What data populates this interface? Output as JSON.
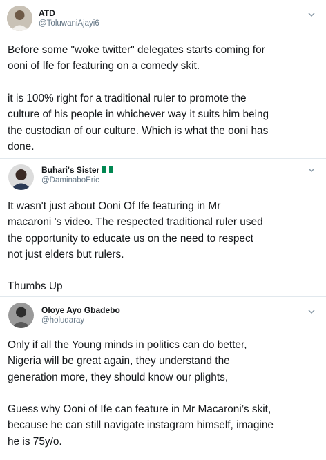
{
  "tweets": [
    {
      "display_name": "ATD",
      "handle": "@ToluwaniAjayi6",
      "paragraphs": [
        "Before some \"woke twitter\" delegates starts coming for\nooni of Ife for featuring on a comedy skit.",
        "it is 100% right for a traditional ruler to promote the\nculture of his people in whichever way it suits him being\nthe custodian of our culture. Which is what the ooni has\ndone."
      ]
    },
    {
      "display_name": "Buhari's Sister",
      "name_emoji": "nigeria-flag",
      "handle": "@DaminaboEric",
      "paragraphs": [
        "It wasn't just about Ooni Of Ife featuring in Mr\nmacaroni 's video. The respected traditional ruler used\nthe opportunity to educate us on the need to respect\nnot just elders but rulers.",
        "Thumbs Up"
      ]
    },
    {
      "display_name": "Oloye Ayo Gbadebo",
      "handle": "@holudaray",
      "paragraphs": [
        "Only if all the Young minds in politics can do better,\nNigeria will be great again, they understand the\ngeneration more, they should know our plights,",
        "Guess why Ooni of Ife can feature in Mr Macaroni’s skit,\nbecause he can still navigate instagram himself, imagine\nhe is 75y/o."
      ]
    }
  ],
  "icons": {
    "menu": "chevron-down-icon",
    "flag": "nigeria-flag-icon"
  },
  "colors": {
    "text": "#14171a",
    "secondary": "#657786",
    "divider": "#e1e8ed",
    "flag_green": "#008751"
  }
}
